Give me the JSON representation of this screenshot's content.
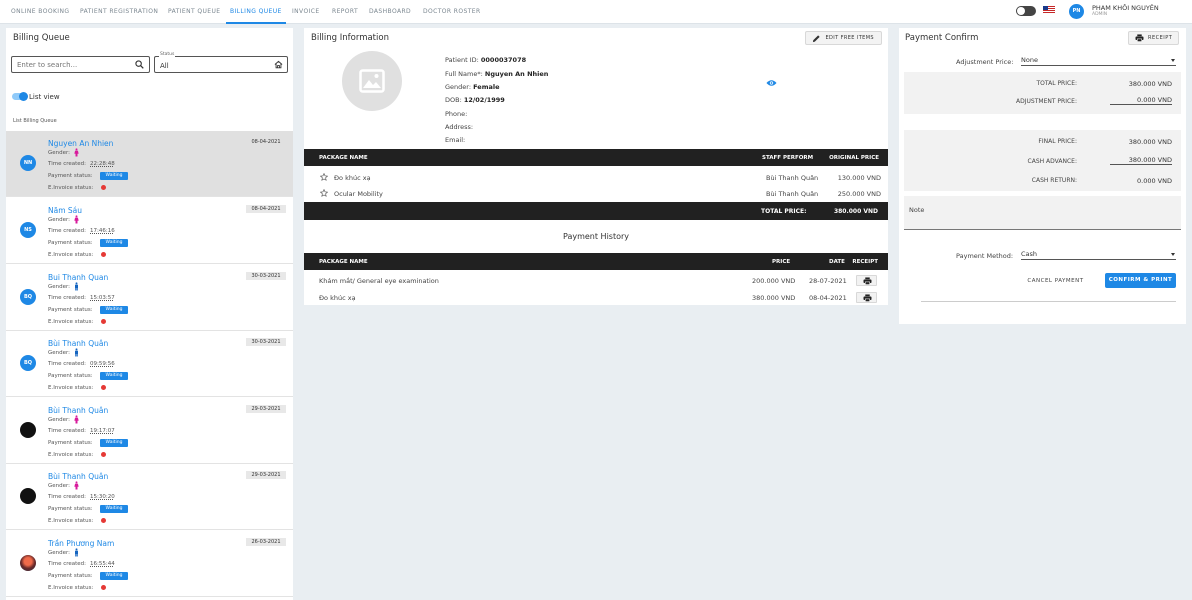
{
  "nav": {
    "items": [
      "ONLINE BOOKING",
      "PATIENT REGISTRATION",
      "PATIENT QUEUE",
      "BILLING QUEUE",
      "INVOICE",
      "REPORT",
      "DASHBOARD",
      "DOCTOR ROSTER"
    ],
    "active_index": 3
  },
  "user": {
    "initials": "PN",
    "name": "PHAM KHÔI NGUYÊN",
    "role": "ADMIN"
  },
  "queue": {
    "title": "Billing Queue",
    "search_placeholder": "Enter to search...",
    "status_label": "Status",
    "status_value": "All",
    "list_view_label": "List view",
    "list_label": "List Billing Queue",
    "gender_label": "Gender:",
    "time_label": "Time created:",
    "payment_label": "Payment status:",
    "einvoice_label": "E.Invoice status:",
    "items": [
      {
        "initials": "NN",
        "name": "Nguyen An Nhien",
        "date": "08-04-2021",
        "time": "22:28:48",
        "status": "Waiting"
      },
      {
        "initials": "NS",
        "name": "Năm Sáu",
        "date": "08-04-2021",
        "time": "17:46:16",
        "status": "Waiting"
      },
      {
        "initials": "BQ",
        "name": "Bui Thanh Quan",
        "date": "30-03-2021",
        "time": "15:03:57",
        "status": "Waiting"
      },
      {
        "initials": "BQ",
        "name": "Bùi Thanh Quân",
        "date": "30-03-2021",
        "time": "09:59:56",
        "status": "Waiting"
      },
      {
        "initials": "",
        "name": "Bùi Thanh Quân",
        "date": "29-03-2021",
        "time": "19:17:07",
        "status": "Waiting"
      },
      {
        "initials": "",
        "name": "Bùi Thanh Quân",
        "date": "29-03-2021",
        "time": "15:30:20",
        "status": "Waiting"
      },
      {
        "initials": "",
        "name": "Trần Phương Nam",
        "date": "26-03-2021",
        "time": "16:55:44",
        "status": "Waiting"
      }
    ]
  },
  "billing": {
    "title": "Billing Information",
    "edit_button": "EDIT FREE ITEMS",
    "patient_id_label": "Patient ID:",
    "patient_id": "0000037078",
    "full_name_label": "Full Name*:",
    "full_name": "Nguyen An Nhien",
    "gender_label": "Gender:",
    "gender": "Female",
    "dob_label": "DOB:",
    "dob": "12/02/1999",
    "phone_label": "Phone:",
    "address_label": "Address:",
    "email_label": "Email:",
    "pkg_headers": {
      "name": "PACKAGE NAME",
      "staff": "STAFF PERFORM",
      "price": "ORIGINAL PRICE"
    },
    "packages": [
      {
        "name": "Đo khúc xạ",
        "staff": "Bùi Thanh Quân",
        "price": "130.000 VND"
      },
      {
        "name": "Ocular Mobility",
        "staff": "Bùi Thanh Quân",
        "price": "250.000 VND"
      }
    ],
    "total_label": "TOTAL PRICE:",
    "total_value": "380.000 VND",
    "history_title": "Payment History",
    "hist_headers": {
      "name": "PACKAGE NAME",
      "price": "PRICE",
      "date": "DATE",
      "receipt": "RECEIPT"
    },
    "history": [
      {
        "name": "Khám mắt/ General eye examination",
        "price": "200.000 VND",
        "date": "28-07-2021"
      },
      {
        "name": "Đo khúc xạ",
        "price": "380.000 VND",
        "date": "08-04-2021"
      }
    ]
  },
  "payment": {
    "title": "Payment Confirm",
    "receipt_button": "RECEIPT",
    "adjustment_label": "Adjustment Price:",
    "adjustment_value": "None",
    "total_price_label": "TOTAL PRICE:",
    "total_price": "380.000 VND",
    "adjustment_price_label": "ADJUSTMENT PRICE:",
    "adjustment_price": "0.000 VND",
    "final_price_label": "FINAL PRICE:",
    "final_price": "380.000 VND",
    "cash_advance_label": "CASH ADVANCE:",
    "cash_advance": "380.000 VND",
    "cash_return_label": "CASH RETURN:",
    "cash_return": "0.000 VND",
    "note_label": "Note",
    "method_label": "Payment Method:",
    "method_value": "Cash",
    "cancel_button": "CANCEL PAYMENT",
    "confirm_button": "CONFIRM & PRINT"
  },
  "colors": {
    "accent": "#1e88e5",
    "table_header": "#212121",
    "female": "#d81b9c",
    "male": "#1565c0",
    "status_dot": "#e53935"
  }
}
